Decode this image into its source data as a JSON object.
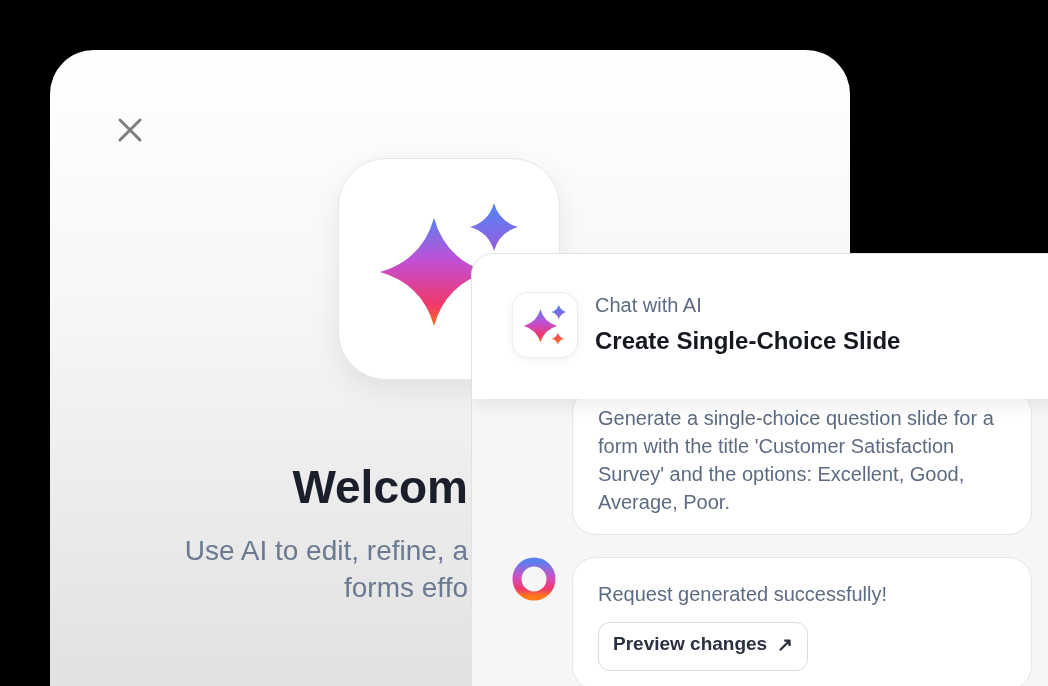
{
  "welcome": {
    "title": "Welcom",
    "subtitle_lines": [
      "Use AI to edit, refine, a",
      "forms effo"
    ]
  },
  "chat": {
    "eyebrow": "Chat with AI",
    "title": "Create Single-Choice Slide",
    "messages": [
      {
        "kind": "user",
        "text": "Generate a single-choice question slide for a form with the title 'Customer Satisfaction Survey' and the options: Excellent, Good, Average, Poor."
      },
      {
        "kind": "assistant",
        "text": "Request generated successfully!",
        "action": {
          "label": "Preview changes",
          "icon": "↗"
        }
      }
    ]
  }
}
